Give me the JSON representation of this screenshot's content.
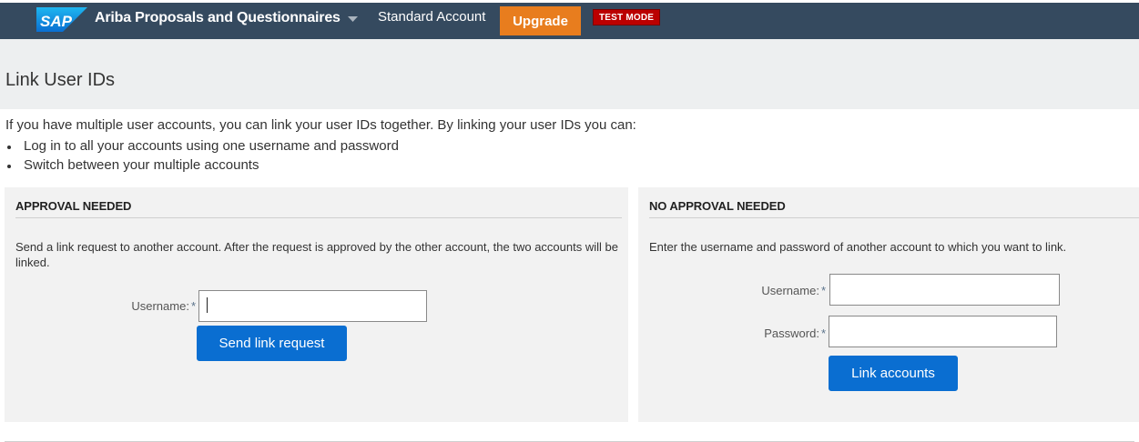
{
  "topbar": {
    "logo_text": "SAP",
    "app_title": "Ariba Proposals and Questionnaires",
    "account_type": "Standard Account",
    "upgrade_label": "Upgrade",
    "test_mode_badge": "TEST MODE",
    "colors": {
      "bar": "#354a5f",
      "upgrade": "#e87d1e",
      "badge": "#bb0000"
    },
    "icons": [
      "chevron-down-icon"
    ]
  },
  "page": {
    "title": "Link User IDs",
    "intro": "If you have multiple user accounts, you can link your user IDs together. By linking your user IDs you can:",
    "bullets": [
      "Log in to all your accounts using one username and password",
      "Switch between your multiple accounts"
    ]
  },
  "approval_needed": {
    "title": "APPROVAL NEEDED",
    "description": "Send a link request to another account. After the request is approved by the other account, the two accounts will be linked.",
    "username_label": "Username:",
    "required_marker": "*",
    "username_value": "",
    "send_button_label": "Send link request"
  },
  "no_approval_needed": {
    "title": "NO APPROVAL NEEDED",
    "description": "Enter the username and password of another account to which you want to link.",
    "username_label": "Username:",
    "password_label": "Password:",
    "required_marker": "*",
    "username_value": "",
    "password_value": "",
    "link_button_label": "Link accounts"
  },
  "accent_color": "#0a6ed1"
}
